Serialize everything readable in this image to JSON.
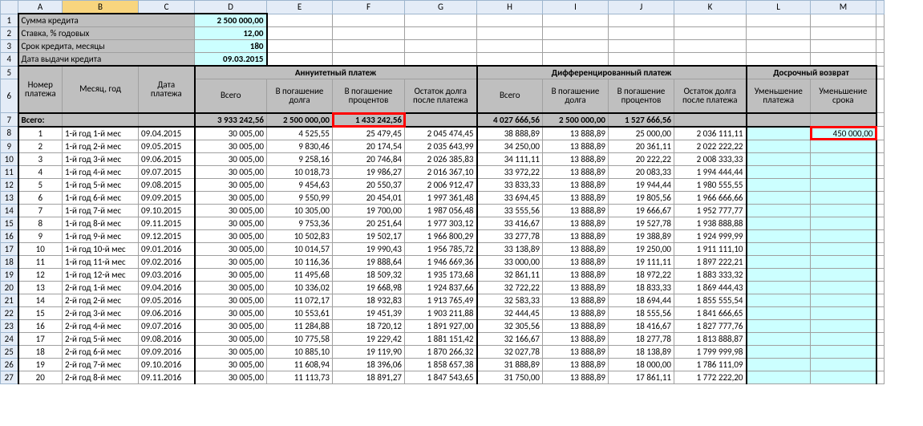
{
  "cols": [
    "",
    "A",
    "B",
    "C",
    "D",
    "E",
    "F",
    "G",
    "H",
    "I",
    "J",
    "K",
    "L",
    "M",
    ""
  ],
  "params": {
    "r1_label": "Сумма кредита",
    "r1_val": "2 500 000,00",
    "r2_label": "Ставка, % годовых",
    "r2_val": "12,00",
    "r3_label": "Срок кредита, месяцы",
    "r3_val": "180",
    "r4_label": "Дата выдачи кредита",
    "r4_val": "09.03.2015"
  },
  "h": {
    "num": "Номер платежа",
    "month": "Месяц, год",
    "date": "Дата платежа",
    "ann": "Аннуитетный платеж",
    "diff": "Дифференцированный платеж",
    "early": "Досрочный возврат",
    "total": "Всего",
    "prin": "В погашение долга",
    "int": "В погашение процентов",
    "bal": "Остаток долга после платежа",
    "less_pay": "Уменьшение платежа",
    "less_term": "Уменьшение срока",
    "all": "Всего:"
  },
  "chart_data": {
    "type": "table",
    "totals": {
      "ann_total": "3 933 242,56",
      "ann_prin": "2 500 000,00",
      "ann_int": "1 433 242,56",
      "diff_total": "4 027 666,56",
      "diff_prin": "2 500 000,00",
      "diff_int": "1 527 666,56"
    },
    "early_first": "450 000,00",
    "rows": [
      {
        "n": "1",
        "m": "1-й год 1-й мес",
        "d": "09.04.2015",
        "at": "30 005,00",
        "ap": "4 525,55",
        "ai": "25 479,45",
        "ab": "2 045 474,45",
        "dt": "38 888,89",
        "dp": "13 888,89",
        "di": "25 000,00",
        "db": "2 036 111,11"
      },
      {
        "n": "2",
        "m": "1-й год 2-й мес",
        "d": "09.05.2015",
        "at": "30 005,00",
        "ap": "9 830,46",
        "ai": "20 174,54",
        "ab": "2 035 643,99",
        "dt": "34 250,00",
        "dp": "13 888,89",
        "di": "20 361,11",
        "db": "2 022 222,22"
      },
      {
        "n": "3",
        "m": "1-й год 3-й мес",
        "d": "09.06.2015",
        "at": "30 005,00",
        "ap": "9 258,16",
        "ai": "20 746,84",
        "ab": "2 026 385,83",
        "dt": "34 111,11",
        "dp": "13 888,89",
        "di": "20 222,22",
        "db": "2 008 333,33"
      },
      {
        "n": "4",
        "m": "1-й год 4-й мес",
        "d": "09.07.2015",
        "at": "30 005,00",
        "ap": "10 018,73",
        "ai": "19 986,27",
        "ab": "2 016 367,10",
        "dt": "33 972,22",
        "dp": "13 888,89",
        "di": "20 083,33",
        "db": "1 994 444,44"
      },
      {
        "n": "5",
        "m": "1-й год 5-й мес",
        "d": "09.08.2015",
        "at": "30 005,00",
        "ap": "9 454,63",
        "ai": "20 550,37",
        "ab": "2 006 912,47",
        "dt": "33 833,33",
        "dp": "13 888,89",
        "di": "19 944,44",
        "db": "1 980 555,55"
      },
      {
        "n": "6",
        "m": "1-й год 6-й мес",
        "d": "09.09.2015",
        "at": "30 005,00",
        "ap": "9 550,99",
        "ai": "20 454,01",
        "ab": "1 997 361,48",
        "dt": "33 694,45",
        "dp": "13 888,89",
        "di": "19 805,56",
        "db": "1 966 666,66"
      },
      {
        "n": "7",
        "m": "1-й год 7-й мес",
        "d": "09.10.2015",
        "at": "30 005,00",
        "ap": "10 305,00",
        "ai": "19 700,00",
        "ab": "1 987 056,48",
        "dt": "33 555,56",
        "dp": "13 888,89",
        "di": "19 666,67",
        "db": "1 952 777,77"
      },
      {
        "n": "8",
        "m": "1-й год 8-й мес",
        "d": "09.11.2015",
        "at": "30 005,00",
        "ap": "9 753,36",
        "ai": "20 251,64",
        "ab": "1 977 303,12",
        "dt": "33 416,67",
        "dp": "13 888,89",
        "di": "19 527,78",
        "db": "1 938 888,88"
      },
      {
        "n": "9",
        "m": "1-й год 9-й мес",
        "d": "09.12.2015",
        "at": "30 005,00",
        "ap": "10 502,83",
        "ai": "19 502,17",
        "ab": "1 966 800,29",
        "dt": "33 277,78",
        "dp": "13 888,89",
        "di": "19 388,89",
        "db": "1 924 999,99"
      },
      {
        "n": "10",
        "m": "1-й год 10-й мес",
        "d": "09.01.2016",
        "at": "30 005,00",
        "ap": "10 014,57",
        "ai": "19 990,43",
        "ab": "1 956 785,72",
        "dt": "33 138,89",
        "dp": "13 888,89",
        "di": "19 250,00",
        "db": "1 911 111,10"
      },
      {
        "n": "11",
        "m": "1-й год 11-й мес",
        "d": "09.02.2016",
        "at": "30 005,00",
        "ap": "10 116,36",
        "ai": "19 888,64",
        "ab": "1 946 669,36",
        "dt": "33 000,00",
        "dp": "13 888,89",
        "di": "19 111,11",
        "db": "1 897 222,21"
      },
      {
        "n": "12",
        "m": "1-й год 12-й мес",
        "d": "09.03.2016",
        "at": "30 005,00",
        "ap": "11 495,68",
        "ai": "18 509,32",
        "ab": "1 935 173,68",
        "dt": "32 861,11",
        "dp": "13 888,89",
        "di": "18 972,22",
        "db": "1 883 333,32"
      },
      {
        "n": "13",
        "m": "2-й год 1-й мес",
        "d": "09.04.2016",
        "at": "30 005,00",
        "ap": "10 336,02",
        "ai": "19 668,98",
        "ab": "1 924 837,66",
        "dt": "32 722,22",
        "dp": "13 888,89",
        "di": "18 833,33",
        "db": "1 869 444,43"
      },
      {
        "n": "14",
        "m": "2-й год 2-й мес",
        "d": "09.05.2016",
        "at": "30 005,00",
        "ap": "11 072,17",
        "ai": "18 932,83",
        "ab": "1 913 765,49",
        "dt": "32 583,33",
        "dp": "13 888,89",
        "di": "18 694,44",
        "db": "1 855 555,54"
      },
      {
        "n": "15",
        "m": "2-й год 3-й мес",
        "d": "09.06.2016",
        "at": "30 005,00",
        "ap": "10 553,61",
        "ai": "19 451,39",
        "ab": "1 903 211,88",
        "dt": "32 444,45",
        "dp": "13 888,89",
        "di": "18 555,56",
        "db": "1 841 666,65"
      },
      {
        "n": "16",
        "m": "2-й год 4-й мес",
        "d": "09.07.2016",
        "at": "30 005,00",
        "ap": "11 284,88",
        "ai": "18 720,12",
        "ab": "1 891 927,00",
        "dt": "32 305,56",
        "dp": "13 888,89",
        "di": "18 416,67",
        "db": "1 827 777,76"
      },
      {
        "n": "17",
        "m": "2-й год 5-й мес",
        "d": "09.08.2016",
        "at": "30 005,00",
        "ap": "10 775,58",
        "ai": "19 229,42",
        "ab": "1 881 151,42",
        "dt": "32 166,67",
        "dp": "13 888,89",
        "di": "18 277,78",
        "db": "1 813 888,87"
      },
      {
        "n": "18",
        "m": "2-й год 6-й мес",
        "d": "09.09.2016",
        "at": "30 005,00",
        "ap": "10 885,10",
        "ai": "19 119,90",
        "ab": "1 870 266,32",
        "dt": "32 027,78",
        "dp": "13 888,89",
        "di": "18 138,89",
        "db": "1 799 999,98"
      },
      {
        "n": "19",
        "m": "2-й год 7-й мес",
        "d": "09.10.2016",
        "at": "30 005,00",
        "ap": "11 608,94",
        "ai": "18 396,06",
        "ab": "1 858 657,38",
        "dt": "31 888,89",
        "dp": "13 888,89",
        "di": "18 000,00",
        "db": "1 786 111,09"
      },
      {
        "n": "20",
        "m": "2-й год 8-й мес",
        "d": "09.11.2016",
        "at": "30 005,00",
        "ap": "11 113,73",
        "ai": "18 891,27",
        "ab": "1 847 543,65",
        "dt": "31 750,00",
        "dp": "13 888,89",
        "di": "17 861,11",
        "db": "1 772 222,20"
      }
    ]
  }
}
